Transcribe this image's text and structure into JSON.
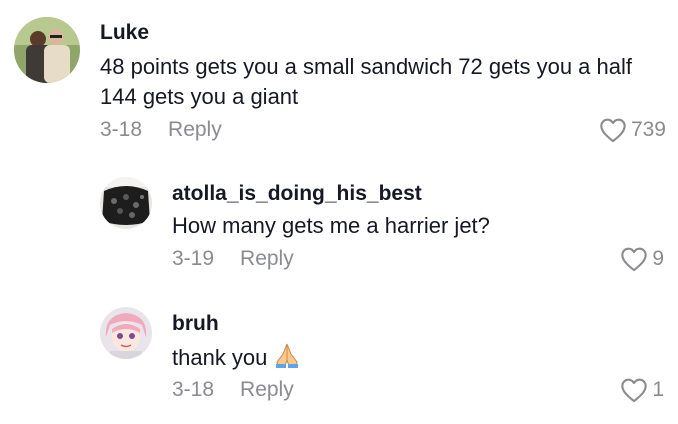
{
  "comments": [
    {
      "username": "Luke",
      "text": "48 points gets you a small sandwich 72 gets you a half 144 gets you a giant",
      "date": "3-18",
      "reply_label": "Reply",
      "likes": "739",
      "avatar_icon": "user-avatar-photo"
    },
    {
      "username": "atolla_is_doing_his_best",
      "text": "How many gets me a harrier jet?",
      "date": "3-19",
      "reply_label": "Reply",
      "likes": "9",
      "avatar_icon": "user-avatar-photo"
    },
    {
      "username": "bruh",
      "text": "thank you",
      "emoji_icon": "folded-hands-emoji",
      "date": "3-18",
      "reply_label": "Reply",
      "likes": "1",
      "avatar_icon": "user-avatar-anime"
    }
  ],
  "colors": {
    "text_primary": "#161823",
    "text_secondary": "#8a8b91",
    "background": "#ffffff"
  }
}
